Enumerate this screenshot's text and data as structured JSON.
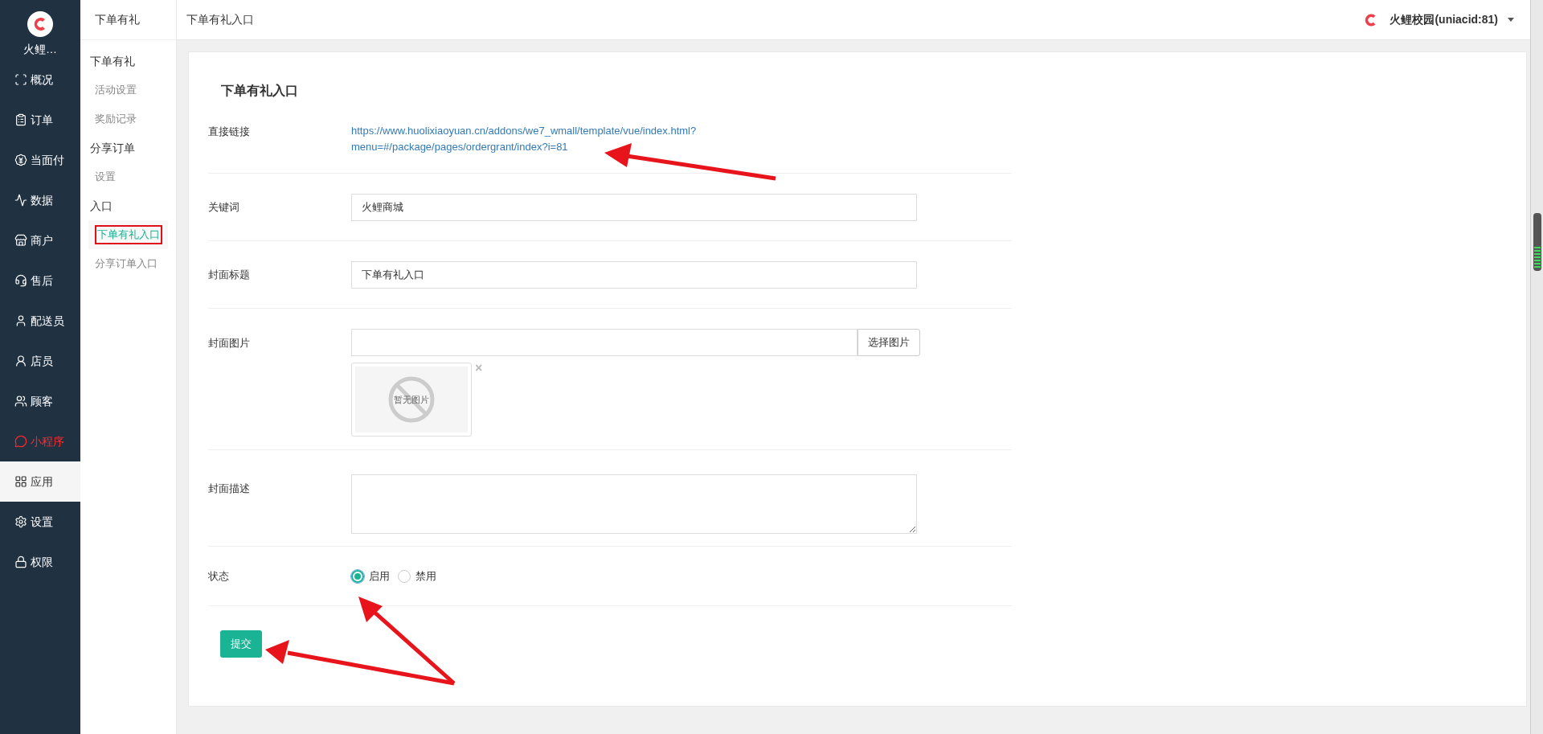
{
  "nav": {
    "brand": "火鲤…",
    "items": [
      {
        "label": "概况",
        "selected": false,
        "highlight": false
      },
      {
        "label": "订单",
        "selected": false,
        "highlight": false
      },
      {
        "label": "当面付",
        "selected": false,
        "highlight": false
      },
      {
        "label": "数据",
        "selected": false,
        "highlight": false
      },
      {
        "label": "商户",
        "selected": false,
        "highlight": false
      },
      {
        "label": "售后",
        "selected": false,
        "highlight": false
      },
      {
        "label": "配送员",
        "selected": false,
        "highlight": false
      },
      {
        "label": "店员",
        "selected": false,
        "highlight": false
      },
      {
        "label": "顾客",
        "selected": false,
        "highlight": false
      },
      {
        "label": "小程序",
        "selected": false,
        "highlight": true
      },
      {
        "label": "应用",
        "selected": true,
        "highlight": false
      },
      {
        "label": "设置",
        "selected": false,
        "highlight": false
      },
      {
        "label": "权限",
        "selected": false,
        "highlight": false
      }
    ]
  },
  "subnav": {
    "title": "下单有礼",
    "groups": [
      {
        "title": "下单有礼",
        "items": [
          {
            "label": "活动设置",
            "selected": false
          },
          {
            "label": "奖励记录",
            "selected": false
          }
        ]
      },
      {
        "title": "分享订单",
        "items": [
          {
            "label": "设置",
            "selected": false
          }
        ]
      },
      {
        "title": "入口",
        "items": [
          {
            "label": "下单有礼入口",
            "selected": true
          },
          {
            "label": "分享订单入口",
            "selected": false
          }
        ]
      }
    ]
  },
  "topbar": {
    "title": "下单有礼入口",
    "account": "火鲤校园(uniacid:81)"
  },
  "form": {
    "heading": "下单有礼入口",
    "fields": [
      {
        "kind": "link",
        "label": "直接链接",
        "lines": [
          "https://www.huolixiaoyuan.cn/addons/we7_wmall/template/vue/index.html?",
          "menu=#/package/pages/ordergrant/index?i=81"
        ]
      },
      {
        "kind": "text",
        "label": "关键词",
        "value": "火鲤商城"
      },
      {
        "kind": "text",
        "label": "封面标题",
        "value": "下单有礼入口"
      },
      {
        "kind": "image",
        "label": "封面图片",
        "button": "选择图片",
        "empty_text": "暂无图片",
        "remove": "×"
      },
      {
        "kind": "textarea",
        "label": "封面描述"
      },
      {
        "kind": "radio",
        "label": "状态",
        "options": [
          {
            "label": "启用",
            "selected": true
          },
          {
            "label": "禁用",
            "selected": false
          }
        ]
      }
    ],
    "submit": "提交"
  }
}
